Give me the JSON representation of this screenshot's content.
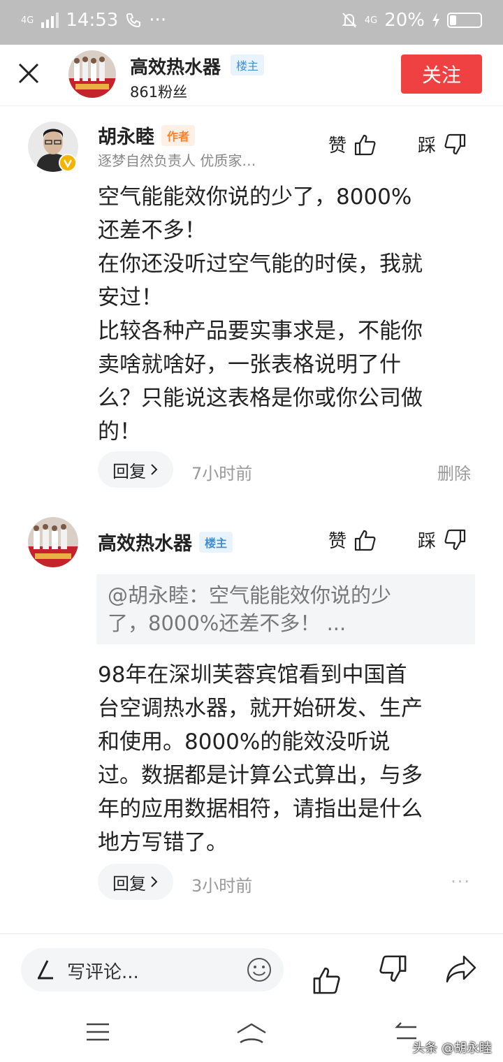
{
  "status_bar": {
    "network_left": "4G",
    "time": "14:53",
    "call_icon": "phone-icon",
    "more": "···",
    "network_right": "4G",
    "battery": "20%",
    "battery_level": 0.2
  },
  "header": {
    "name": "高效热水器",
    "badge": "楼主",
    "fans": "861粉丝",
    "follow_label": "关注"
  },
  "comments": [
    {
      "name": "胡永睦",
      "badge": "作者",
      "subtitle": "逐梦自然负责人 优质家…",
      "like_label": "赞",
      "dislike_label": "踩",
      "body_lines": [
        "空气能能效你说的少了，8000%",
        "还差不多！",
        "在你还没听过空气能的时侯，我就",
        "安过！",
        "比较各种产品要实事求是，不能你",
        "卖啥就啥好，一张表格说明了什",
        "么？只能说这表格是你或你公司做",
        "的！"
      ],
      "reply_label": "回复",
      "time": "7小时前",
      "delete_label": "删除"
    },
    {
      "name": "高效热水器",
      "badge": "楼主",
      "like_label": "赞",
      "dislike_label": "踩",
      "quote_lines": [
        "@胡永睦：空气能能效你说的少",
        "了，8000%还差不多！ ..."
      ],
      "body_lines": [
        "98年在深圳芙蓉宾馆看到中国首",
        "台空调热水器，就开始研发、生产",
        "和使用。8000%的能效没听说",
        "过。数据都是计算公式算出，与多",
        "年的应用数据相符，请指出是什么",
        "地方写错了。"
      ],
      "reply_label": "回复",
      "time": "3小时前",
      "more": "···"
    }
  ],
  "bottom_bar": {
    "placeholder": "写评论..."
  },
  "watermark": "头条 @胡永睦"
}
